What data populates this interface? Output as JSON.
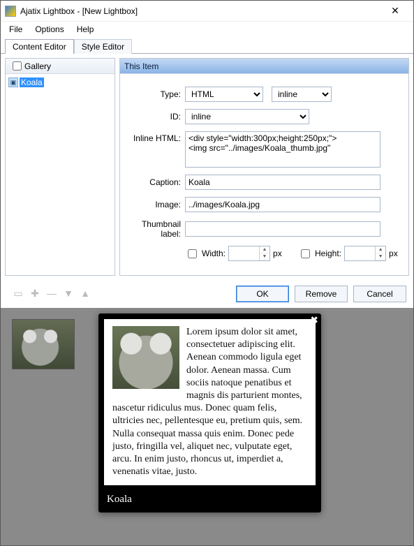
{
  "window": {
    "title": "Ajatix Lightbox - [New Lightbox]"
  },
  "menu": {
    "file": "File",
    "options": "Options",
    "help": "Help"
  },
  "tabs": {
    "content": "Content Editor",
    "style": "Style Editor"
  },
  "gallery": {
    "header": "Gallery",
    "checked": false,
    "items": [
      "Koala"
    ]
  },
  "item": {
    "header": "This Item",
    "labels": {
      "type": "Type:",
      "id": "ID:",
      "inlineHtml": "Inline HTML:",
      "caption": "Caption:",
      "image": "Image:",
      "thumb": "Thumbnail label:",
      "width": "Width:",
      "height": "Height:",
      "px": "px"
    },
    "values": {
      "type": "HTML",
      "mode": "inline",
      "id": "inline",
      "inlineHtml": "<div style=\"width:300px;height:250px;\">\n<img src=\"../images/Koala_thumb.jpg\"",
      "caption": "Koala",
      "image": "../images/Koala.jpg",
      "thumb": "",
      "width": "",
      "height": ""
    }
  },
  "buttons": {
    "ok": "OK",
    "remove": "Remove",
    "cancel": "Cancel"
  },
  "preview": {
    "caption": "Koala",
    "body": "Lorem ipsum dolor sit amet, consectetuer adipiscing elit. Aenean commodo ligula eget dolor. Aenean massa. Cum sociis natoque penatibus et magnis dis parturient montes, nascetur ridiculus mus. Donec quam felis, ultricies nec, pellentesque eu, pretium quis, sem. Nulla consequat massa quis enim. Donec pede justo, fringilla vel, aliquet nec, vulputate eget, arcu. In enim justo, rhoncus ut, imperdiet a, venenatis vitae, justo."
  }
}
